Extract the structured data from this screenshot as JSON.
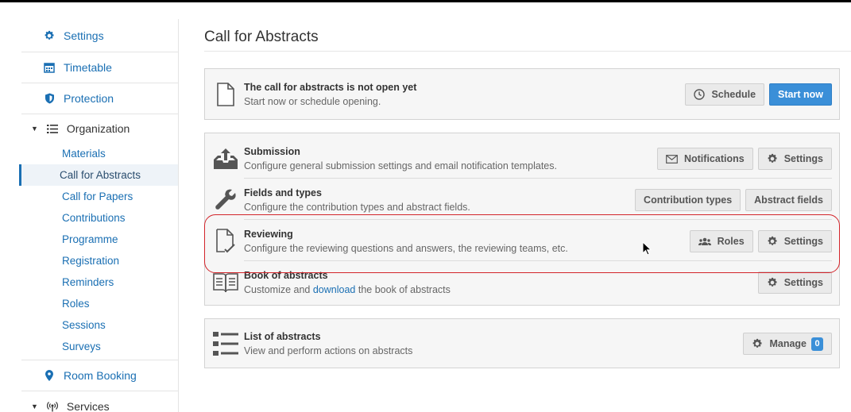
{
  "sidebar": {
    "items": [
      {
        "label": "Settings",
        "icon": "gear-icon"
      },
      {
        "label": "Timetable",
        "icon": "calendar-icon"
      },
      {
        "label": "Protection",
        "icon": "shield-icon"
      }
    ],
    "organization": {
      "label": "Organization",
      "subitems": [
        "Materials",
        "Call for Abstracts",
        "Call for Papers",
        "Contributions",
        "Programme",
        "Registration",
        "Reminders",
        "Roles",
        "Sessions",
        "Surveys"
      ],
      "active": "Call for Abstracts"
    },
    "room_booking": "Room Booking",
    "services": "Services"
  },
  "main": {
    "title": "Call for Abstracts",
    "status_card": {
      "title": "The call for abstracts is not open yet",
      "desc": "Start now or schedule opening.",
      "schedule_label": "Schedule",
      "start_label": "Start now"
    },
    "modules": {
      "submission": {
        "title": "Submission",
        "desc": "Configure general submission settings and email notification templates.",
        "btn1": "Notifications",
        "btn2": "Settings"
      },
      "fields": {
        "title": "Fields and types",
        "desc": "Configure the contribution types and abstract fields.",
        "btn1": "Contribution types",
        "btn2": "Abstract fields"
      },
      "reviewing": {
        "title": "Reviewing",
        "desc": "Configure the reviewing questions and answers, the reviewing teams, etc.",
        "btn1": "Roles",
        "btn2": "Settings"
      },
      "book": {
        "title": "Book of abstracts",
        "desc_pre": "Customize and",
        "desc_link": "download",
        "desc_post": "the book of abstracts",
        "btn1": "Settings"
      }
    },
    "list_card": {
      "title": "List of abstracts",
      "desc": "View and perform actions on abstracts",
      "manage_label": "Manage",
      "count": "0"
    }
  },
  "colors": {
    "accent": "#3a8fd8",
    "link": "#1a6fb3",
    "highlight": "#d3242a"
  }
}
